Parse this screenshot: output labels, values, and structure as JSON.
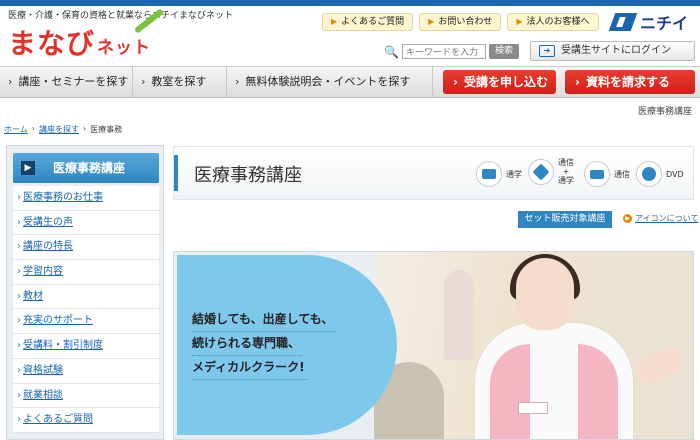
{
  "header": {
    "tagline": "医療・介護・保育の資格と就業ならニチイまなびネット",
    "logo_main": "まなび",
    "logo_sub": "ネット",
    "toplinks": [
      {
        "label": "よくあるご質問"
      },
      {
        "label": "お問い合わせ"
      },
      {
        "label": "法人のお客様へ"
      }
    ],
    "brand": "ニチイ",
    "search": {
      "placeholder": "キーワードを入力",
      "button": "検索"
    },
    "login_label": "受講生サイトにログイン"
  },
  "nav": {
    "items": [
      {
        "label": "講座・セミナーを探す"
      },
      {
        "label": "教室を探す"
      },
      {
        "label": "無料体験説明会・イベントを探す"
      }
    ],
    "cta_apply": "受講を申し込む",
    "cta_request": "資料を請求する"
  },
  "page_label": "医療事務講座",
  "breadcrumb": [
    "ホーム",
    "講座を探す",
    "医療事務"
  ],
  "sidebar": {
    "title": "医療事務講座",
    "items": [
      {
        "label": "医療事務のお仕事"
      },
      {
        "label": "受講生の声"
      },
      {
        "label": "講座の特長"
      },
      {
        "label": "学習内容"
      },
      {
        "label": "教材"
      },
      {
        "label": "充実のサポート"
      },
      {
        "label": "受講料・割引制度"
      },
      {
        "label": "資格試験"
      },
      {
        "label": "就業相談"
      },
      {
        "label": "よくあるご質問"
      }
    ]
  },
  "title_panel": {
    "title": "医療事務講座",
    "modes": [
      {
        "label": "通学",
        "icon": "classroom-icon"
      },
      {
        "label_lines": [
          "通信",
          "+",
          "通学"
        ],
        "icon": "mixed-icon"
      },
      {
        "label": "通信",
        "icon": "mail-icon"
      },
      {
        "label": "DVD",
        "icon": "dvd-icon"
      }
    ]
  },
  "set_label": "セット販売対象講座",
  "icon_about": "アイコンについて",
  "hero": {
    "lines": [
      "結婚しても、出産しても、",
      "続けられる専門職、",
      "メディカルクラーク!"
    ]
  },
  "colors": {
    "accent_blue": "#2f86c1",
    "brand_red": "#e4322b",
    "hero_blue": "#7ec8ec"
  }
}
